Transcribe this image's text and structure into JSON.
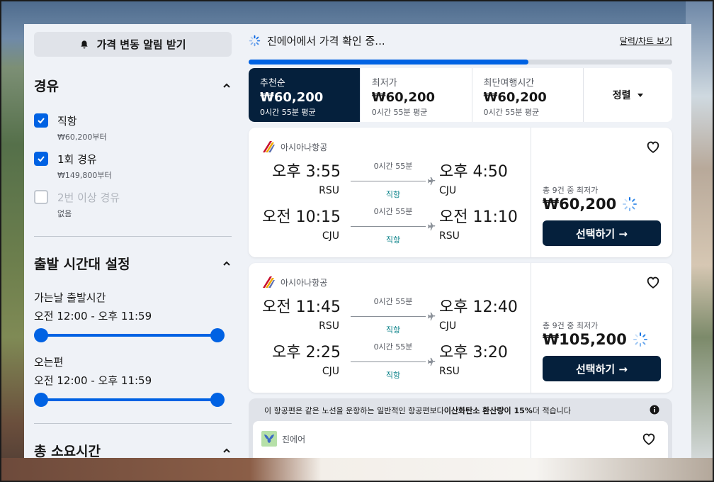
{
  "alert_button": {
    "label": "가격 변동 알림 받기"
  },
  "stops_filter": {
    "title": "경유",
    "options": [
      {
        "label": "직항",
        "sub": "₩60,200부터",
        "checked": true
      },
      {
        "label": "1회 경유",
        "sub": "₩149,800부터",
        "checked": true
      },
      {
        "label": "2번 이상 경유",
        "sub": "없음",
        "checked": false
      }
    ]
  },
  "time_filter": {
    "title": "출발 시간대 설정",
    "outbound": {
      "title": "가는날 출발시간",
      "range": "오전 12:00 - 오후 11:59"
    },
    "return": {
      "title": "오는편",
      "range": "오전 12:00 - 오후 11:59"
    }
  },
  "duration_filter": {
    "title": "총 소요시간"
  },
  "status": {
    "text": "진에어에서 가격 확인 중...",
    "link": "달력/차트 보기",
    "progress_fraction": 0.66
  },
  "sort_tabs": [
    {
      "label": "추천순",
      "price": "₩60,200",
      "duration": "0시간 55분 평균",
      "active": true
    },
    {
      "label": "최저가",
      "price": "₩60,200",
      "duration": "0시간 55분 평균",
      "active": false
    },
    {
      "label": "최단여행시간",
      "price": "₩60,200",
      "duration": "0시간 55분 평균",
      "active": false
    }
  ],
  "sort_dropdown": {
    "label": "정렬"
  },
  "results": [
    {
      "airline": "아시아나항공",
      "legs": [
        {
          "dep_time": "오후 3:55",
          "dep_code": "RSU",
          "duration": "0시간 55분",
          "stops": "직항",
          "arr_time": "오후 4:50",
          "arr_code": "CJU"
        },
        {
          "dep_time": "오전 10:15",
          "dep_code": "CJU",
          "duration": "0시간 55분",
          "stops": "직항",
          "arr_time": "오전 11:10",
          "arr_code": "RSU"
        }
      ],
      "price_note": "총 9건 중 최저가",
      "price": "₩60,200",
      "select_label": "선택하기 →"
    },
    {
      "airline": "아시아나항공",
      "legs": [
        {
          "dep_time": "오전 11:45",
          "dep_code": "RSU",
          "duration": "0시간 55분",
          "stops": "직항",
          "arr_time": "오후 12:40",
          "arr_code": "CJU"
        },
        {
          "dep_time": "오후 2:25",
          "dep_code": "CJU",
          "duration": "0시간 55분",
          "stops": "직항",
          "arr_time": "오후 3:20",
          "arr_code": "RSU"
        }
      ],
      "price_note": "총 9건 중 최저가",
      "price": "₩105,200",
      "select_label": "선택하기 →"
    }
  ],
  "eco_notice": {
    "prefix": "이 항공편은 같은 노선을 운항하는 일반적인 항공편보다 ",
    "highlight": "이산화탄소 환산량이 15%",
    "suffix": " 더 적습니다"
  },
  "third_result": {
    "airline": "진에어"
  },
  "colors": {
    "accent": "#0062e3",
    "dark": "#05203c",
    "teal": "#0c838a"
  }
}
